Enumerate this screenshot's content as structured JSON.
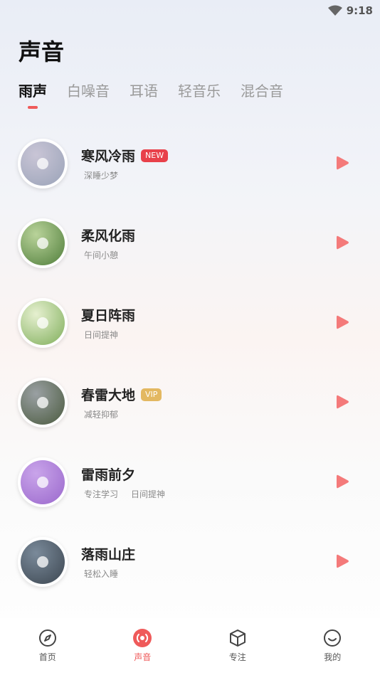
{
  "status": {
    "time": "9:18"
  },
  "page": {
    "title": "声音"
  },
  "tabs": [
    {
      "label": "雨声",
      "active": true
    },
    {
      "label": "白噪音",
      "active": false
    },
    {
      "label": "耳语",
      "active": false
    },
    {
      "label": "轻音乐",
      "active": false
    },
    {
      "label": "混合音",
      "active": false
    }
  ],
  "sounds": [
    {
      "title": "寒风冷雨",
      "badge": "NEW",
      "badge_type": "new",
      "tags": [
        "深睡少梦"
      ],
      "cover_colors": [
        "#c9c5d6",
        "#9aa3b8"
      ]
    },
    {
      "title": "柔风化雨",
      "badge": "",
      "badge_type": "",
      "tags": [
        "午间小憩"
      ],
      "cover_colors": [
        "#b9d39a",
        "#4f7d3a"
      ]
    },
    {
      "title": "夏日阵雨",
      "badge": "",
      "badge_type": "",
      "tags": [
        "日间提神"
      ],
      "cover_colors": [
        "#e6f0d0",
        "#7fae5a"
      ]
    },
    {
      "title": "春雷大地",
      "badge": "VIP",
      "badge_type": "vip",
      "tags": [
        "减轻抑郁"
      ],
      "cover_colors": [
        "#9aa0a3",
        "#4a5a3e"
      ]
    },
    {
      "title": "雷雨前夕",
      "badge": "",
      "badge_type": "",
      "tags": [
        "专注学习",
        "日间提神"
      ],
      "cover_colors": [
        "#c9a4ea",
        "#9a68cc"
      ]
    },
    {
      "title": "落雨山庄",
      "badge": "",
      "badge_type": "",
      "tags": [
        "轻松入睡"
      ],
      "cover_colors": [
        "#7a8a9a",
        "#3c4650"
      ]
    }
  ],
  "nav": [
    {
      "label": "首页",
      "icon": "compass-icon",
      "active": false
    },
    {
      "label": "声音",
      "icon": "sound-icon",
      "active": true
    },
    {
      "label": "专注",
      "icon": "cube-icon",
      "active": false
    },
    {
      "label": "我的",
      "icon": "smile-icon",
      "active": false
    }
  ],
  "colors": {
    "accent": "#ef5a5a",
    "play": "#f47a7a",
    "new_badge": "#e8404a",
    "vip_badge": "#e3b861"
  }
}
